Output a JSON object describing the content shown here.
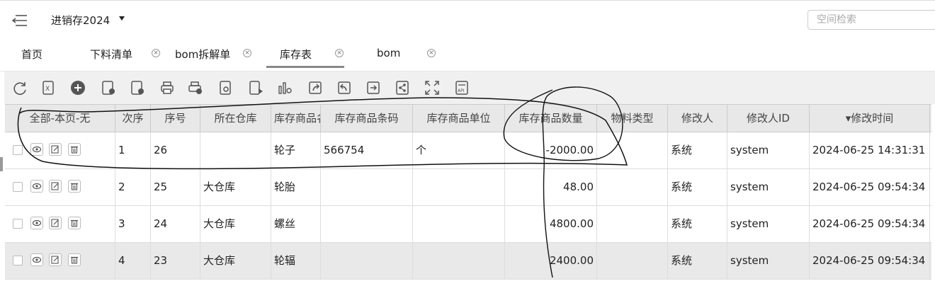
{
  "header": {
    "app_title": "进销存2024",
    "search_placeholder": "空间检索"
  },
  "tabs": [
    {
      "label": "首页",
      "closable": false
    },
    {
      "label": "下料清单",
      "closable": true
    },
    {
      "label": "bom拆解单",
      "closable": true
    },
    {
      "label": "库存表",
      "closable": true,
      "active": true
    },
    {
      "label": "bom",
      "closable": true
    }
  ],
  "toolbar_icons": [
    "refresh-icon",
    "export-excel-icon",
    "add-icon",
    "approve-icon",
    "reject-icon",
    "print-icon",
    "print-add-icon",
    "print-settings-icon",
    "run-report-icon",
    "chart-icon",
    "share-out-icon",
    "import-icon",
    "forward-icon",
    "share-link-icon",
    "fullscreen-icon",
    "api-icon"
  ],
  "table": {
    "select_header": "全部-本页-无",
    "columns": [
      "次序",
      "序号",
      "所在仓库",
      "库存商品名称",
      "库存商品条码",
      "库存商品单位",
      "库存商品数量",
      "物料类型",
      "修改人",
      "修改人ID",
      "▾修改时间"
    ],
    "rows": [
      {
        "order": "1",
        "id": "26",
        "warehouse": "",
        "name": "轮子",
        "barcode": "566754",
        "unit": "个",
        "qty": "-2000.00",
        "type": "",
        "modifier": "系统",
        "modifier_id": "system",
        "time": "2024-06-25 14:31:31"
      },
      {
        "order": "2",
        "id": "25",
        "warehouse": "大仓库",
        "name": "轮胎",
        "barcode": "",
        "unit": "",
        "qty": "48.00",
        "type": "",
        "modifier": "系统",
        "modifier_id": "system",
        "time": "2024-06-25 09:54:34"
      },
      {
        "order": "3",
        "id": "24",
        "warehouse": "大仓库",
        "name": "螺丝",
        "barcode": "",
        "unit": "",
        "qty": "4800.00",
        "type": "",
        "modifier": "系统",
        "modifier_id": "system",
        "time": "2024-06-25 09:54:34"
      },
      {
        "order": "4",
        "id": "23",
        "warehouse": "大仓库",
        "name": "轮辐",
        "barcode": "",
        "unit": "",
        "qty": "2400.00",
        "type": "",
        "modifier": "系统",
        "modifier_id": "system",
        "time": "2024-06-25 09:54:34"
      }
    ]
  },
  "colors": {
    "accent_bar": "#888888",
    "row_highlight": "#e9e9ea",
    "header_bg": "#e8e8e8"
  }
}
